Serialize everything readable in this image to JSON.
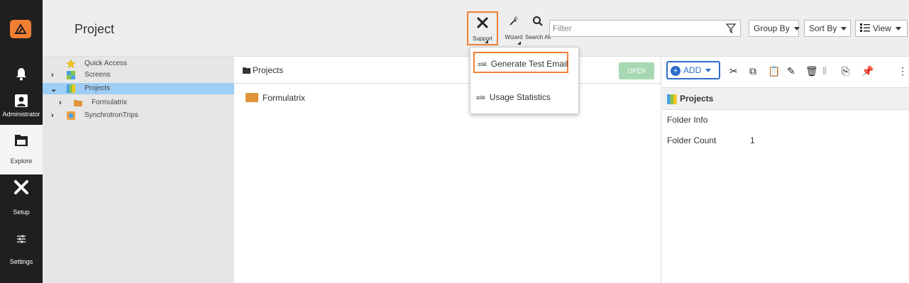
{
  "header": {
    "title": "Project",
    "toolbar": {
      "support_label": "Support",
      "wizard_label": "Wizard",
      "search_all_label": "Search All"
    },
    "filter": {
      "placeholder": "Filter"
    },
    "group_by_label": "Group By",
    "sort_by_label": "Sort By",
    "view_label": "View"
  },
  "leftnav": {
    "administrator_label": "Administrator",
    "explore_label": "Explore",
    "setup_label": "Setup",
    "settings_label": "Settings"
  },
  "tree": {
    "items": [
      {
        "label": "Quick Access"
      },
      {
        "label": "Screens"
      },
      {
        "label": "Projects"
      },
      {
        "label": "Formulatrix"
      },
      {
        "label": "SynchrotronTrips"
      }
    ]
  },
  "main": {
    "breadcrumb": "Projects",
    "open_label": "OPEN",
    "folders": [
      {
        "label": "Formulatrix"
      }
    ]
  },
  "right": {
    "add_label": "ADD",
    "header_label": "Projects",
    "folder_info_label": "Folder Info",
    "folder_count_label": "Folder Count",
    "folder_count_value": "1"
  },
  "menu": {
    "items": [
      {
        "label": "Generate Test Email"
      },
      {
        "label": "Usage Statistics"
      }
    ]
  },
  "colors": {
    "accent_orange": "#f07f32",
    "selection_blue": "#9ecdf5",
    "add_blue": "#2d6ccb",
    "open_green": "#a7d8b4",
    "nav_dark": "#1f1f1f"
  }
}
